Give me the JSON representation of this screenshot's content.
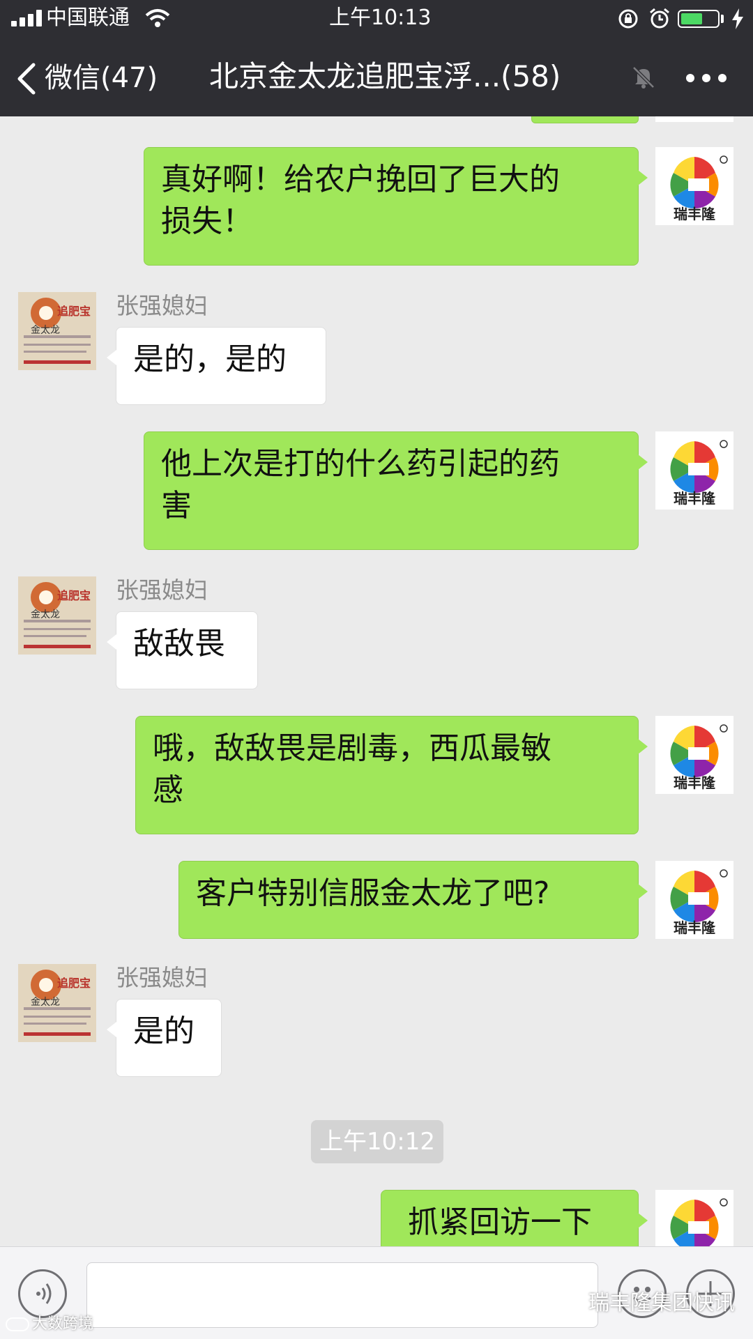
{
  "status_bar": {
    "carrier": "中国联通",
    "time": "上午10:13"
  },
  "nav": {
    "back_label": "微信(47)",
    "title": "北京金太龙追肥宝浮...(58)"
  },
  "me": {
    "avatar_text": "瑞丰隆"
  },
  "other": {
    "avatar_title": "追肥宝",
    "avatar_brand": "金太龙"
  },
  "messages": [
    {
      "text_l1": "真好啊！给农户挽回了巨大的",
      "text_l2": "损失！"
    },
    {
      "sender": "张强媳妇",
      "text": "是的，是的"
    },
    {
      "text_l1": "他上次是打的什么药引起的药",
      "text_l2": "害"
    },
    {
      "sender": "张强媳妇",
      "text": "敌敌畏"
    },
    {
      "text_l1": "哦，敌敌畏是剧毒，西瓜最敏",
      "text_l2": "感"
    },
    {
      "text": "客户特别信服金太龙了吧?"
    },
    {
      "sender": "张强媳妇",
      "text": "是的"
    },
    {
      "time": "上午10:12"
    },
    {
      "text": "抓紧回访一下"
    }
  ],
  "watermark": {
    "right": "瑞丰隆集团快讯",
    "left": "大数跨境"
  },
  "colors": {
    "bar": "#2e2e33",
    "out_bubble": "#a0e75a",
    "in_bubble": "#ffffff",
    "bg": "#ebebeb"
  }
}
